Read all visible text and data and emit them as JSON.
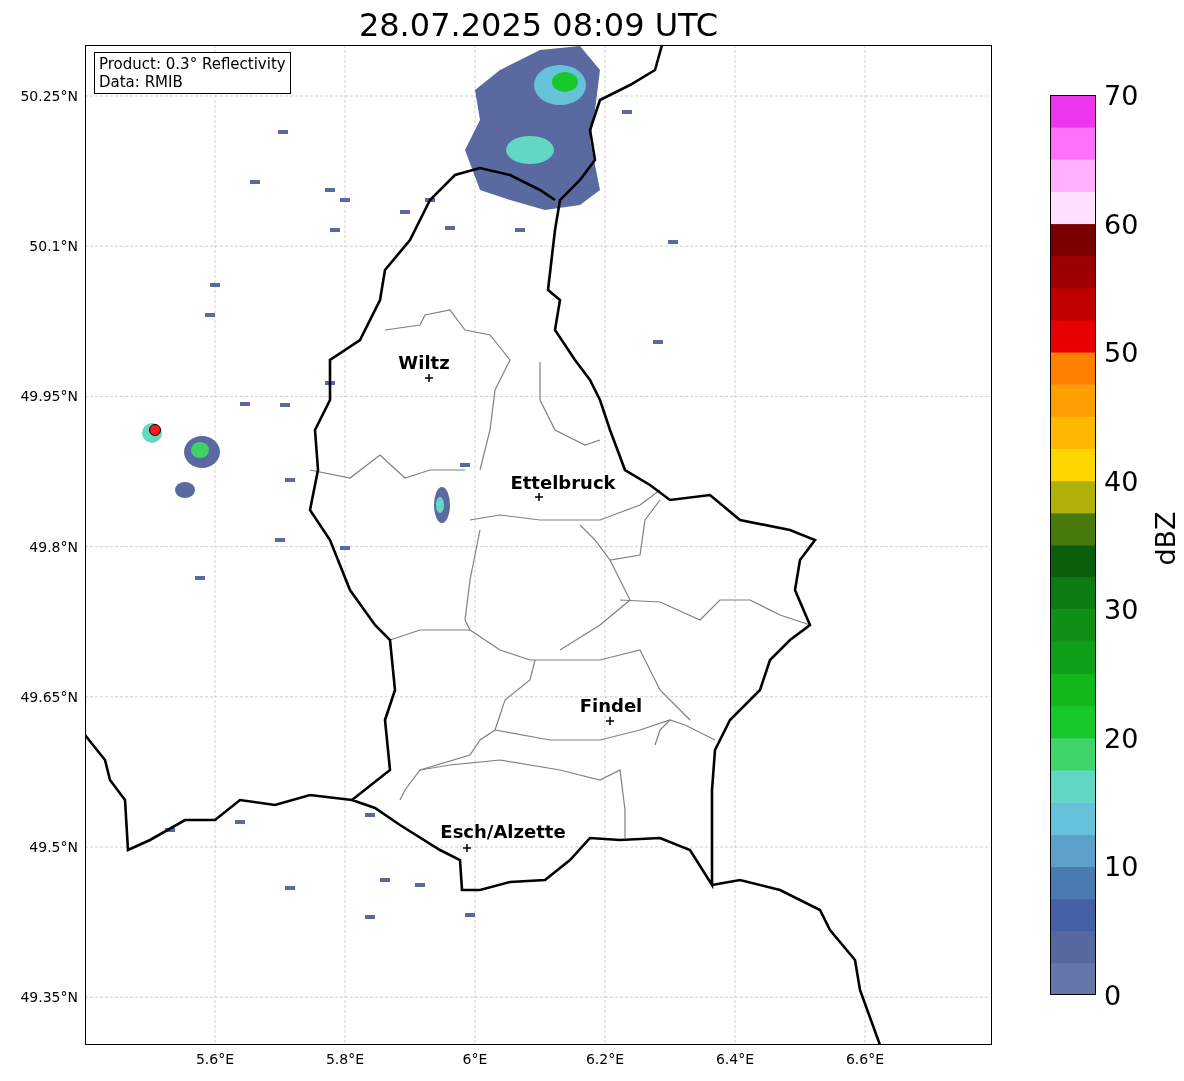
{
  "title": "28.07.2025 08:09 UTC",
  "info_box": {
    "product": "Product: 0.3° Reflectivity",
    "data": "Data: RMIB"
  },
  "map": {
    "lon_ticks": [
      "5.6°E",
      "5.8°E",
      "6°E",
      "6.2°E",
      "6.4°E",
      "6.6°E"
    ],
    "lat_ticks": [
      "50.25°N",
      "50.1°N",
      "49.95°N",
      "49.8°N",
      "49.65°N",
      "49.5°N",
      "49.35°N"
    ],
    "cities": [
      {
        "name": "Wiltz"
      },
      {
        "name": "Ettelbruck"
      },
      {
        "name": "Findel"
      },
      {
        "name": "Esch/Alzette"
      }
    ]
  },
  "colorbar": {
    "label": "dBZ",
    "ticks": [
      "70",
      "60",
      "50",
      "40",
      "30",
      "20",
      "10",
      "0"
    ],
    "bands": [
      {
        "color": "#6577a8"
      },
      {
        "color": "#55699f"
      },
      {
        "color": "#4660a8"
      },
      {
        "color": "#4a7ab2"
      },
      {
        "color": "#5aa0c8"
      },
      {
        "color": "#65c2da"
      },
      {
        "color": "#62d8c4"
      },
      {
        "color": "#3fd46a"
      },
      {
        "color": "#17c82a"
      },
      {
        "color": "#12b81a"
      },
      {
        "color": "#10a018"
      },
      {
        "color": "#0f8f16"
      },
      {
        "color": "#0c7b12"
      },
      {
        "color": "#0a5e0c"
      },
      {
        "color": "#477a0a"
      },
      {
        "color": "#b0b00a"
      },
      {
        "color": "#ffd700"
      },
      {
        "color": "#ffb800"
      },
      {
        "color": "#ff9e00"
      },
      {
        "color": "#ff8000"
      },
      {
        "color": "#e60000"
      },
      {
        "color": "#c00000"
      },
      {
        "color": "#9c0000"
      },
      {
        "color": "#7a0000"
      },
      {
        "color": "#ffe0ff"
      },
      {
        "color": "#ffb0ff"
      },
      {
        "color": "#ff70f8"
      },
      {
        "color": "#ee35ee"
      }
    ]
  }
}
